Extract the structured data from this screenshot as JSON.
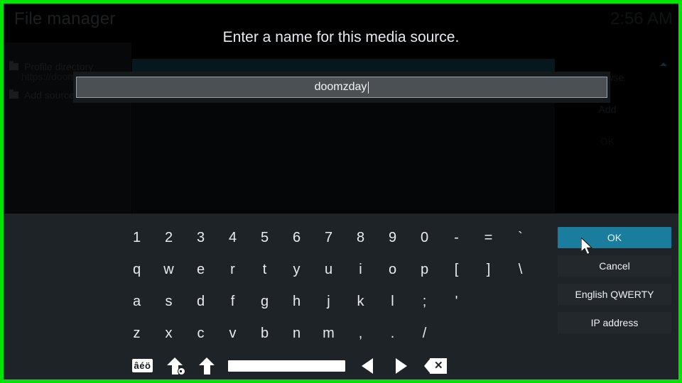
{
  "background_app": {
    "title": "File manager",
    "clock": "2:56 AM",
    "nav_items": [
      {
        "label": "Profile directory",
        "icon": "folder-icon"
      },
      {
        "label": "Add source",
        "icon": "folder-icon"
      }
    ],
    "source_path": "https://doomzdayteam.github.io/doomzday",
    "buttons": {
      "browse": "Browse",
      "add": "Add",
      "ok": "OK"
    }
  },
  "dialog": {
    "heading": "Enter a name for this media source.",
    "input_value": "doomzday",
    "input_placeholder": ""
  },
  "keyboard": {
    "rows": [
      [
        "1",
        "2",
        "3",
        "4",
        "5",
        "6",
        "7",
        "8",
        "9",
        "0",
        "-",
        "=",
        "`"
      ],
      [
        "q",
        "w",
        "e",
        "r",
        "t",
        "y",
        "u",
        "i",
        "o",
        "p",
        "[",
        "]",
        "\\"
      ],
      [
        "a",
        "s",
        "d",
        "f",
        "g",
        "h",
        "j",
        "k",
        "l",
        ";",
        "'"
      ],
      [
        "z",
        "x",
        "c",
        "v",
        "b",
        "n",
        "m",
        ",",
        ".",
        "/"
      ]
    ],
    "function_row": {
      "accents_label": "âéö",
      "caps_lock": "caps-lock-key",
      "shift": "shift-key",
      "space": "space-key",
      "cursor_left": "cursor-left-key",
      "cursor_right": "cursor-right-key",
      "backspace": "backspace-key"
    },
    "actions": [
      {
        "label": "OK",
        "selected": true
      },
      {
        "label": "Cancel",
        "selected": false
      },
      {
        "label": "English QWERTY",
        "selected": false
      },
      {
        "label": "IP address",
        "selected": false
      }
    ]
  },
  "colors": {
    "screen_border": "#00e500",
    "accent_selected": "#1a7d9e",
    "keyboard_bg": "#1e2327",
    "button_bg": "#23282c",
    "input_bg": "#4b5054"
  }
}
